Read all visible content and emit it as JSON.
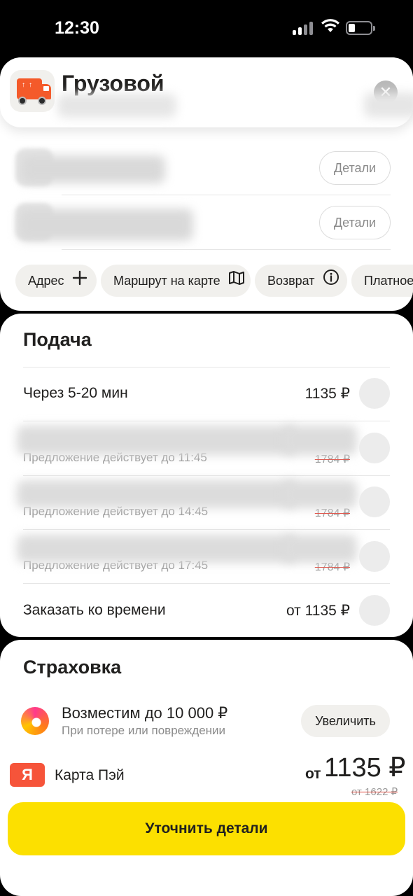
{
  "status_bar": {
    "time": "12:30"
  },
  "header": {
    "title": "Грузовой",
    "close_icon": "close-icon",
    "tariff_icon": "truck-icon"
  },
  "route": {
    "details_label": "Детали",
    "chips": [
      {
        "label": "Адрес",
        "icon": "plus-icon"
      },
      {
        "label": "Маршрут на карте",
        "icon": "map-icon"
      },
      {
        "label": "Возврат",
        "icon": "info-icon"
      },
      {
        "label": "Платное"
      }
    ]
  },
  "pickup": {
    "title": "Подача",
    "options": [
      {
        "label": "Через 5-20 мин",
        "price": "1135 ₽"
      },
      {
        "sub": "Предложение действует до 11:45",
        "old_price": "1784 ₽"
      },
      {
        "sub": "Предложение действует до 14:45",
        "old_price": "1784 ₽"
      },
      {
        "sub": "Предложение действует до 17:45",
        "old_price": "1784 ₽"
      },
      {
        "label": "Заказать ко времени",
        "price": "от 1135 ₽"
      }
    ]
  },
  "insurance": {
    "title": "Страховка",
    "item_title": "Возместим до 10 000 ₽",
    "item_sub": "При потере или повреждении",
    "increase_label": "Увеличить"
  },
  "payment": {
    "logo_text": "Я",
    "label": "Карта Пэй",
    "total_prefix": "от",
    "total_amount": "1135 ₽",
    "total_old": "от 1622 ₽"
  },
  "cta": {
    "label": "Уточнить детали"
  },
  "colors": {
    "accent": "#fce000",
    "truck": "#f45a2a",
    "strike": "#e0453a"
  }
}
